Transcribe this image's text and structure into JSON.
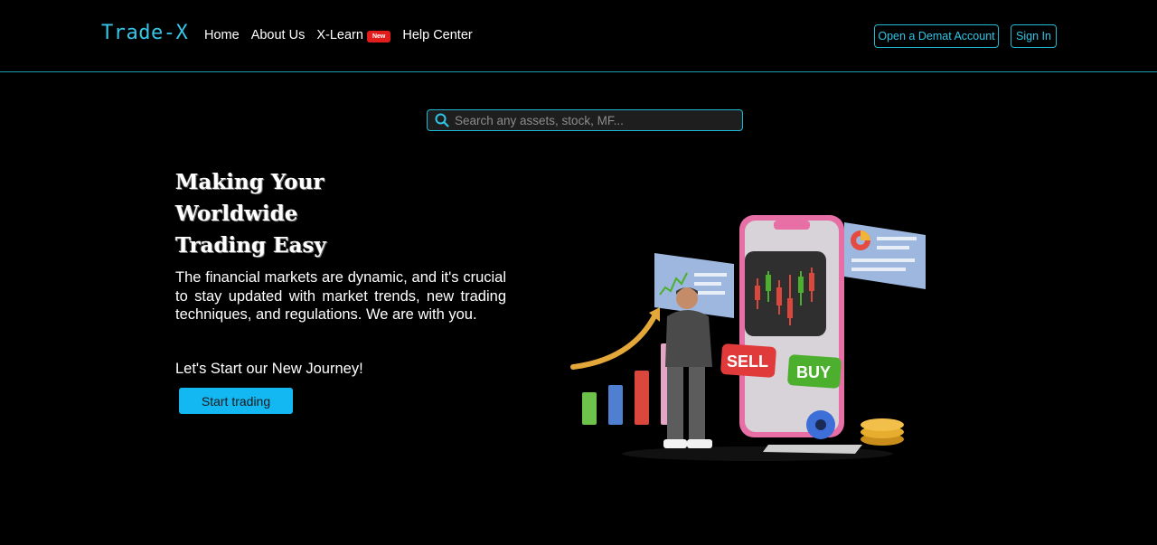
{
  "brand": "Trade-X",
  "nav": {
    "home": "Home",
    "about": "About Us",
    "xlearn": "X-Learn",
    "xlearn_badge": "New",
    "help": "Help Center"
  },
  "actions": {
    "demat": "Open a Demat Account",
    "signin": "Sign In"
  },
  "search": {
    "placeholder": "Search any assets, stock, MF..."
  },
  "hero": {
    "title_line1": "Making Your",
    "title_line2": "Worldwide",
    "title_line3": "Trading Easy",
    "description": "The financial markets are dynamic, and it's crucial to stay updated with market trends, new trading techniques, and regulations. We are with you.",
    "journey": "Let's Start our New Journey!",
    "cta": "Start trading"
  },
  "illustration": {
    "sell_label": "SELL",
    "buy_label": "BUY"
  },
  "colors": {
    "accent": "#1fb8d6",
    "brand": "#36c6e8",
    "cta": "#13b7f2",
    "badge": "#e21b1b",
    "sell": "#e03a3a",
    "buy": "#4caf2d",
    "phone": "#e76fa6"
  }
}
